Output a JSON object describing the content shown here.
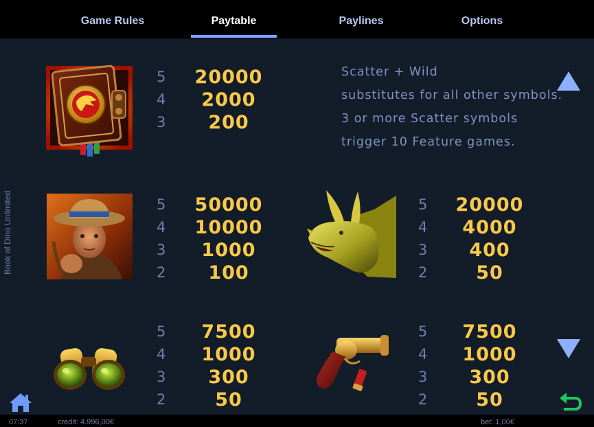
{
  "tabs": [
    {
      "label": "Game Rules",
      "active": false
    },
    {
      "label": "Paytable",
      "active": true
    },
    {
      "label": "Paylines",
      "active": false
    },
    {
      "label": "Options",
      "active": false
    }
  ],
  "game_title": "Book of Dino Unlimited",
  "paytable": {
    "book": {
      "counts": [
        "5",
        "4",
        "3"
      ],
      "pays": [
        "20000",
        "2000",
        "200"
      ]
    },
    "explorer": {
      "counts": [
        "5",
        "4",
        "3",
        "2"
      ],
      "pays": [
        "50000",
        "10000",
        "1000",
        "100"
      ]
    },
    "triceratops": {
      "counts": [
        "5",
        "4",
        "3",
        "2"
      ],
      "pays": [
        "20000",
        "4000",
        "400",
        "50"
      ]
    },
    "binoculars": {
      "counts": [
        "5",
        "4",
        "3",
        "2"
      ],
      "pays": [
        "7500",
        "1000",
        "300",
        "50"
      ]
    },
    "flare_gun": {
      "counts": [
        "5",
        "4",
        "3",
        "2"
      ],
      "pays": [
        "7500",
        "1000",
        "300",
        "50"
      ]
    }
  },
  "scatter_info": {
    "lines": [
      "Scatter + Wild",
      "substitutes for all other symbols.",
      "3 or more Scatter symbols",
      "trigger 10 Feature games."
    ]
  },
  "status": {
    "time": "07:37",
    "credit": "credit: 4.996,00€",
    "bet": "bet: 1,00€"
  },
  "colors": {
    "background": "#131c29",
    "payout": "#ffc94a",
    "count": "#6f80ad",
    "info_text": "#7e93c2",
    "tab_active_underline": "#7ea0ff",
    "arrow": "#8fb0ff",
    "back_icon": "#22c55e"
  },
  "icons": [
    "home-icon",
    "back-arrow-icon",
    "scroll-up-icon",
    "scroll-down-icon"
  ]
}
